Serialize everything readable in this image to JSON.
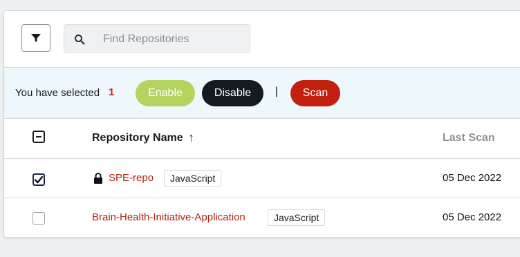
{
  "toolbar": {
    "filter_icon": "filter-icon",
    "search_icon": "search-icon",
    "search_placeholder": "Find Repositories",
    "search_value": ""
  },
  "selection_bar": {
    "label": "You have selected",
    "count": "1",
    "enable_label": "Enable",
    "disable_label": "Disable",
    "separator": "|",
    "scan_label": "Scan",
    "colors": {
      "enable": "#b5d35f",
      "disable": "#151a1f",
      "scan": "#c3200f",
      "count": "#d0261b"
    }
  },
  "table": {
    "headers": {
      "name": "Repository Name",
      "sort_indicator": "↑",
      "last_scan": "Last Scan"
    },
    "rows": [
      {
        "name": "SPE-repo",
        "private": true,
        "language": "JavaScript",
        "last_scan": "05 Dec 2022",
        "selected": true
      },
      {
        "name": "Brain-Health-Initiative-Application",
        "private": false,
        "language": "JavaScript",
        "last_scan": "05 Dec 2022",
        "selected": false
      }
    ],
    "link_color": "#b5230f"
  }
}
